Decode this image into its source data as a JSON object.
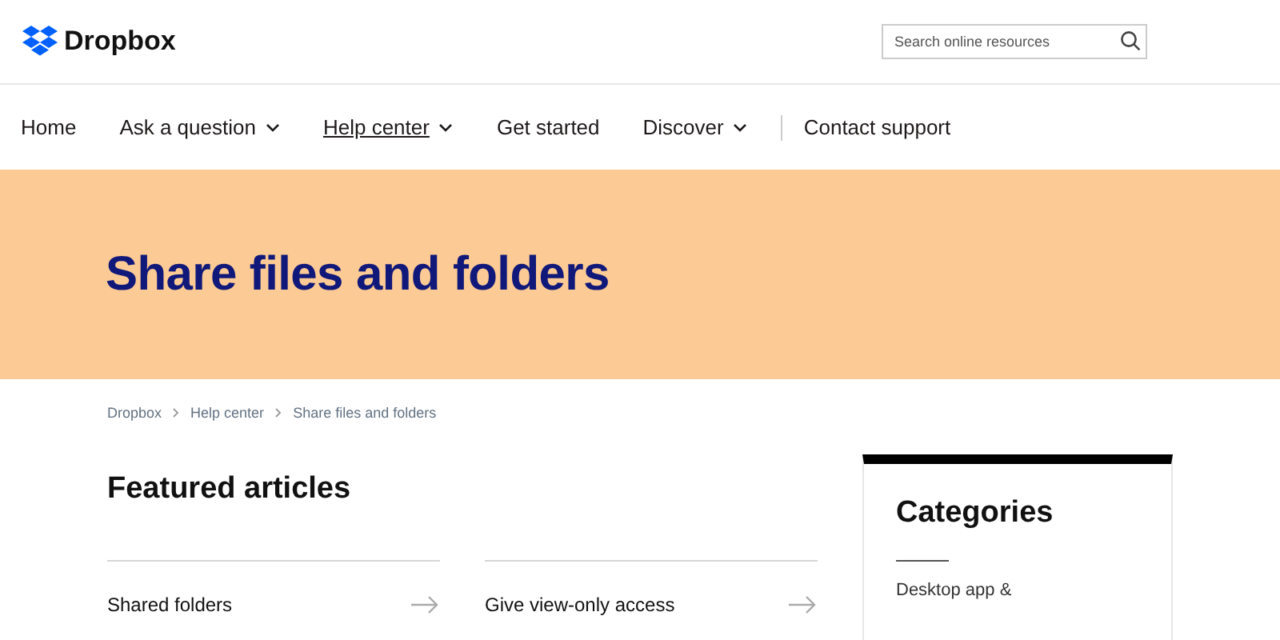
{
  "header": {
    "logo": "Dropbox",
    "search": {
      "placeholder": "Search online resources"
    }
  },
  "nav": [
    {
      "label": "Home",
      "dropdown": false,
      "selected": false
    },
    {
      "label": "Ask a question",
      "dropdown": true,
      "selected": false
    },
    {
      "label": "Help center",
      "dropdown": true,
      "selected": true
    },
    {
      "label": "Get started",
      "dropdown": false,
      "selected": false
    },
    {
      "label": "Discover",
      "dropdown": true,
      "selected": false
    },
    {
      "label": "Contact support",
      "dropdown": false,
      "selected": false
    }
  ],
  "hero": {
    "title": "Share files and folders"
  },
  "breadcrumbs": [
    "Dropbox",
    "Help center",
    "Share files and folders"
  ],
  "featured": {
    "title": "Featured articles",
    "articles": [
      "Shared folders",
      "Give view-only access"
    ]
  },
  "categories": {
    "title": "Categories",
    "items": [
      "Desktop app &"
    ]
  }
}
